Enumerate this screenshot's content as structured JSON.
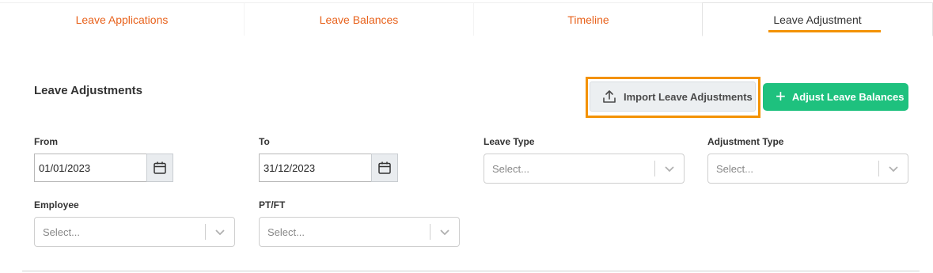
{
  "tabs": [
    {
      "label": "Leave Applications"
    },
    {
      "label": "Leave Balances"
    },
    {
      "label": "Timeline"
    },
    {
      "label": "Leave Adjustment"
    }
  ],
  "section": {
    "title": "Leave Adjustments"
  },
  "actions": {
    "import_label": "Import Leave Adjustments",
    "adjust_label": "Adjust Leave Balances"
  },
  "filters": {
    "from": {
      "label": "From",
      "value": "01/01/2023"
    },
    "to": {
      "label": "To",
      "value": "31/12/2023"
    },
    "leave_type": {
      "label": "Leave Type",
      "placeholder": "Select..."
    },
    "adjustment_type": {
      "label": "Adjustment Type",
      "placeholder": "Select..."
    },
    "employee": {
      "label": "Employee",
      "placeholder": "Select..."
    },
    "ptft": {
      "label": "PT/FT",
      "placeholder": "Select..."
    }
  },
  "colors": {
    "tab_accent": "#e8621c",
    "highlight": "#f39200",
    "primary": "#1ec17e"
  },
  "icons": {
    "import": "upload-icon",
    "adjust": "plus-icon",
    "date": "calendar-icon",
    "select": "chevron-down-icon"
  }
}
